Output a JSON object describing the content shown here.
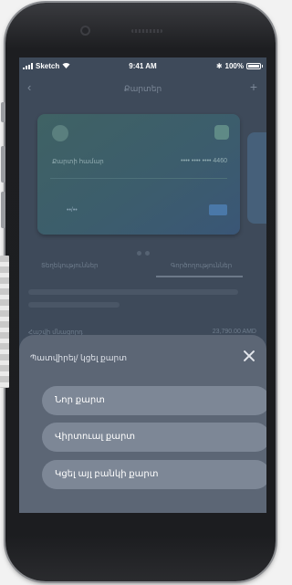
{
  "status_bar": {
    "carrier": "Sketch",
    "time": "9:41 AM",
    "battery": "100%"
  },
  "background_page": {
    "nav_title": "Քարտեր",
    "card_label": "Քարտի համար",
    "card_number": "•••• •••• •••• 4460",
    "card_expiry": "••/••",
    "tab_left": "Տեղեկություններ",
    "tab_right": "Գործողություններ",
    "balance_label": "Հաշվի մնացորդ",
    "balance_value": "23,790.00 AMD"
  },
  "sheet": {
    "title": "Պատվիրել/ կցել քարտ",
    "options": [
      {
        "label": "Նոր քարտ"
      },
      {
        "label": "Վիրտուալ քարտ"
      },
      {
        "label": "Կցել այլ բանկի քարտ"
      }
    ]
  },
  "colors": {
    "sheet_bg": "#5c6675",
    "option_bg": "#7d8796",
    "overlay_bg": "#3e4a5a"
  }
}
